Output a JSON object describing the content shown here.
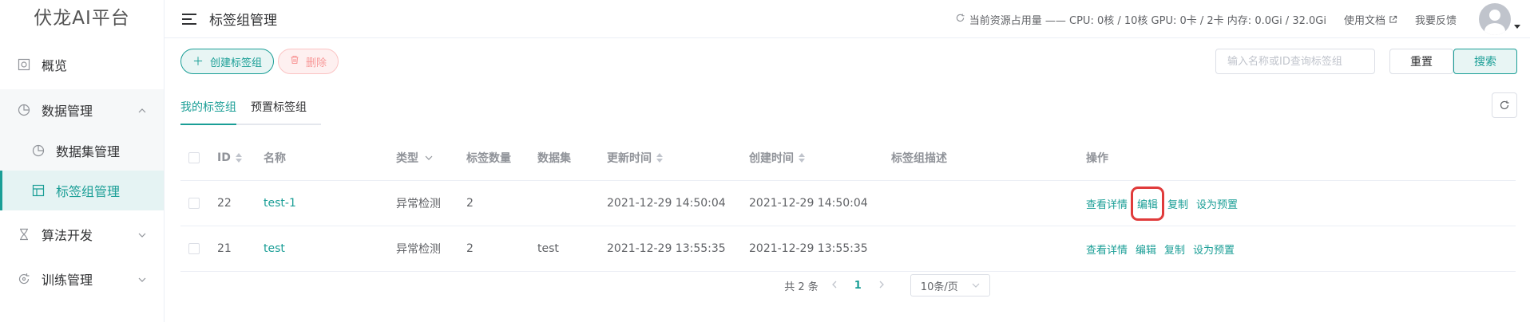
{
  "app": {
    "title": "伏龙AI平台"
  },
  "sidebar": {
    "items": [
      {
        "label": "概览"
      },
      {
        "label": "数据管理",
        "expanded": true,
        "children": [
          {
            "label": "数据集管理"
          },
          {
            "label": "标签组管理",
            "active": true
          }
        ]
      },
      {
        "label": "算法开发"
      },
      {
        "label": "训练管理"
      }
    ]
  },
  "header": {
    "page_title": "标签组管理",
    "usage_text": "当前资源占用量 —— CPU: 0核 / 10核 GPU: 0卡 / 2卡 内存: 0.0Gi / 32.0Gi",
    "docs_label": "使用文档",
    "feedback_label": "我要反馈"
  },
  "toolbar": {
    "create_label": "创建标签组",
    "delete_label": "删除",
    "search_placeholder": "输入名称或ID查询标签组",
    "reset_label": "重置",
    "search_label": "搜索"
  },
  "tabs": [
    {
      "label": "我的标签组",
      "active": true
    },
    {
      "label": "预置标签组"
    }
  ],
  "table": {
    "columns": {
      "id": "ID",
      "name": "名称",
      "type": "类型",
      "label_count": "标签数量",
      "dataset": "数据集",
      "updated": "更新时间",
      "created": "创建时间",
      "description": "标签组描述",
      "actions": "操作"
    },
    "rows": [
      {
        "id": "22",
        "name": "test-1",
        "type": "异常检测",
        "label_count": "2",
        "dataset": "",
        "updated": "2021-12-29 14:50:04",
        "created": "2021-12-29 14:50:04",
        "description": ""
      },
      {
        "id": "21",
        "name": "test",
        "type": "异常检测",
        "label_count": "2",
        "dataset": "test",
        "updated": "2021-12-29 13:55:35",
        "created": "2021-12-29 13:55:35",
        "description": ""
      }
    ],
    "actions": {
      "view": "查看详情",
      "edit": "编辑",
      "copy": "复制",
      "preset": "设为预置"
    }
  },
  "pagination": {
    "total_text": "共 2 条",
    "current_page": "1",
    "page_size": "10条/页"
  },
  "colors": {
    "accent": "#1a9e96",
    "danger": "#f89898",
    "highlight": "#e03b3b"
  }
}
